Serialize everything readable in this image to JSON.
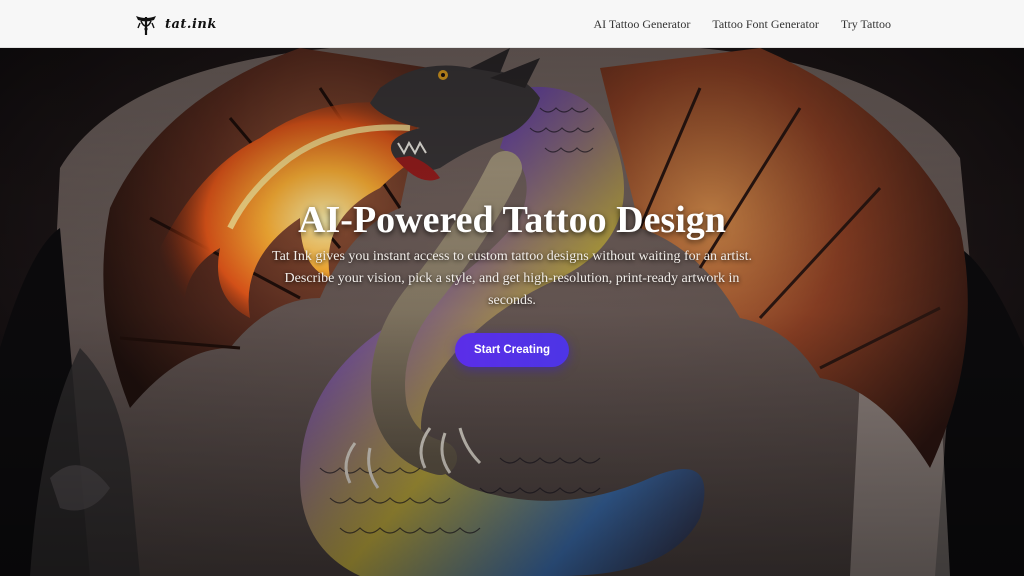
{
  "header": {
    "logo_text": "tat.ink",
    "nav": [
      {
        "label": "AI Tattoo Generator"
      },
      {
        "label": "Tattoo Font Generator"
      },
      {
        "label": "Try Tattoo"
      }
    ]
  },
  "hero": {
    "title": "AI-Powered Tattoo Design",
    "description": "Tat Ink gives you instant access to custom tattoo designs without waiting for an artist. Describe your vision, pick a style, and get high-resolution, print-ready artwork in seconds.",
    "cta_label": "Start Creating",
    "image_subject": "dragon-back-tattoo"
  },
  "colors": {
    "header_bg": "#f7f7f7",
    "cta_start": "#5b2ee8",
    "cta_end": "#4d35e6",
    "title": "#ffffff",
    "background": "#0b0a0c"
  }
}
